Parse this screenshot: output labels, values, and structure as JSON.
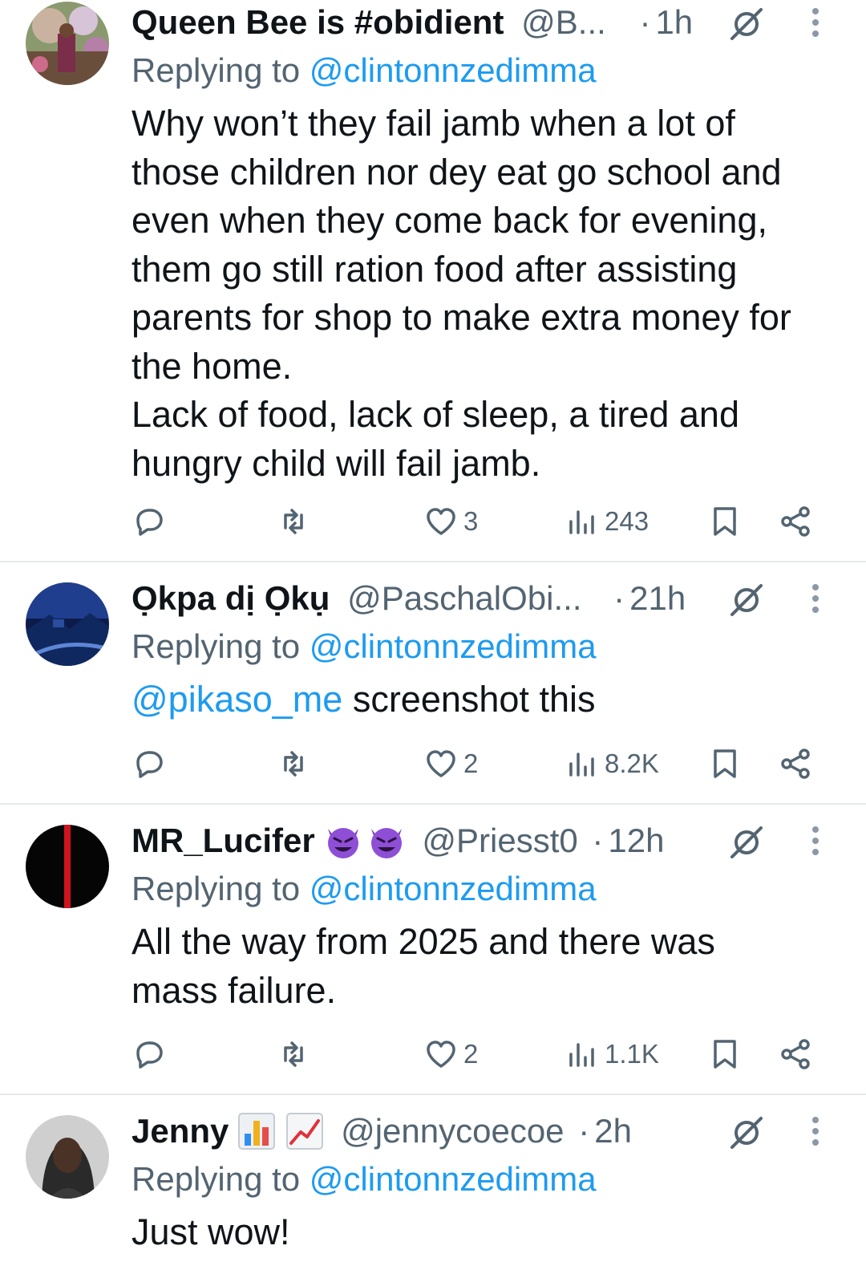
{
  "colors": {
    "link": "#1d9bf0",
    "secondary": "#536471",
    "primary": "#0f1419",
    "divider": "#e6e9eb"
  },
  "reply_prefix": "Replying to",
  "tweets": [
    {
      "name": "Queen Bee is #obidient",
      "handle": "@B...",
      "time": "1h",
      "replying_to": "@clintonnzedimma",
      "body_lines": [
        "Why won’t they fail jamb when a lot of",
        "those children nor dey eat go school and",
        "even when they come back for evening,",
        "them go still ration food after assisting",
        "parents for shop to make extra money for",
        "the home.",
        "Lack of food, lack of sleep, a tired and",
        "hungry child will fail jamb."
      ],
      "likes": "3",
      "views": "243"
    },
    {
      "name": "Ọkpa dị Ọkụ",
      "handle": "@PaschalObi...",
      "time": "21h",
      "replying_to": "@clintonnzedimma",
      "body_mention": "@pikaso_me",
      "body_text": " screenshot this",
      "likes": "2",
      "views": "8.2K"
    },
    {
      "name": "MR_Lucifer",
      "name_emojis": [
        "smiling-face-with-horns",
        "smiling-face-with-horns"
      ],
      "handle": "@Priesst0",
      "time": "12h",
      "replying_to": "@clintonnzedimma",
      "body_lines": [
        "All the way from 2025 and there was",
        "mass failure."
      ],
      "likes": "2",
      "views": "1.1K"
    },
    {
      "name": "Jenny",
      "name_emojis": [
        "bar-chart",
        "chart-increasing"
      ],
      "handle": "@jennycoecoe",
      "time": "2h",
      "replying_to": "@clintonnzedimma",
      "body_lines": [
        "Just wow!"
      ]
    }
  ]
}
